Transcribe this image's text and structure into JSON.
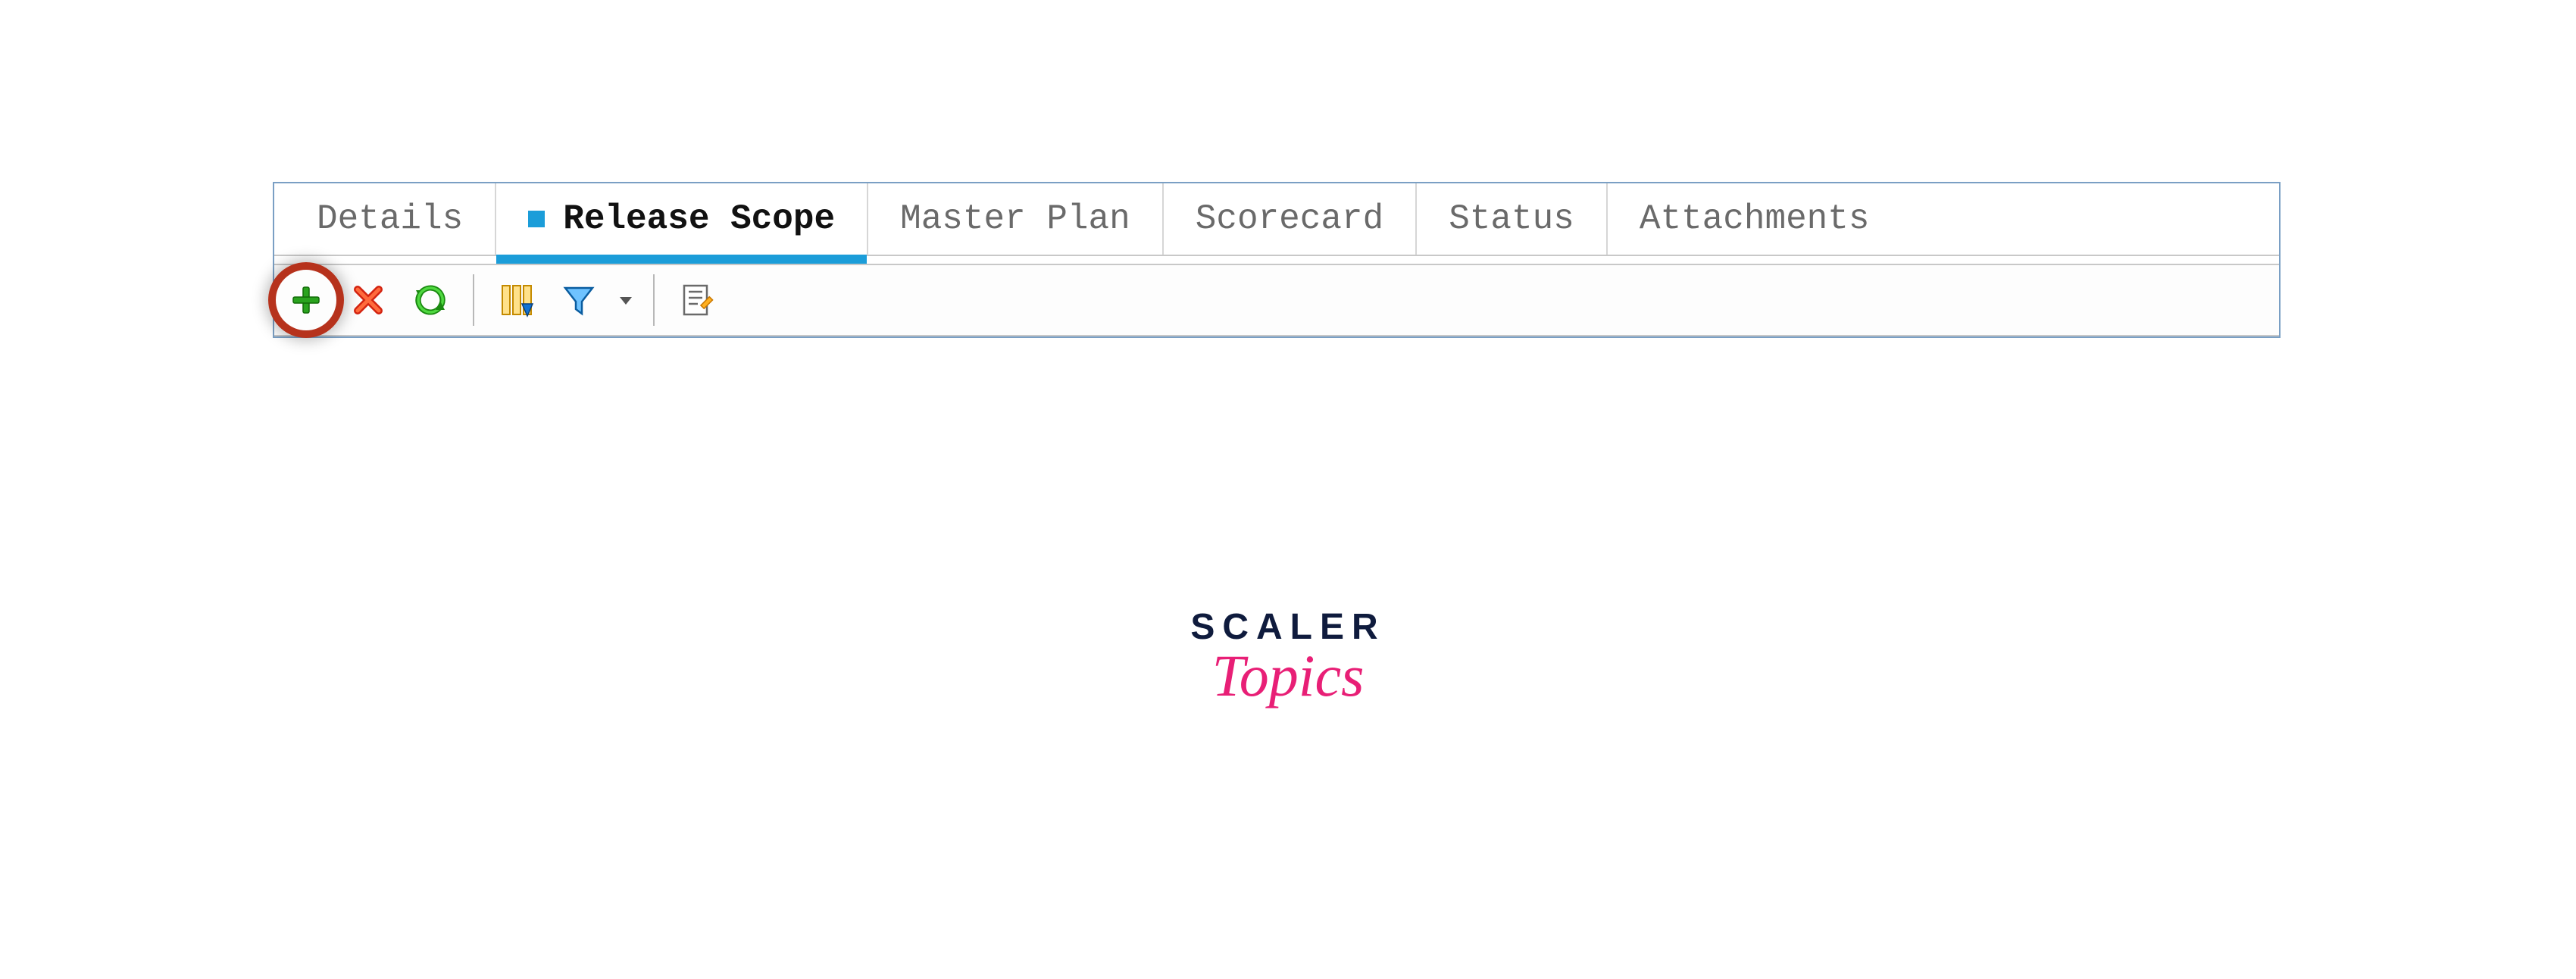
{
  "tabs": {
    "details": "Details",
    "release_scope": "Release Scope",
    "master_plan": "Master Plan",
    "scorecard": "Scorecard",
    "status": "Status",
    "attachments": "Attachments",
    "active": "release_scope"
  },
  "toolbar": {
    "add": "Add",
    "delete": "Delete",
    "refresh": "Refresh",
    "columns": "Select Columns",
    "filter": "Filter",
    "filter_dropdown": "Filter Options",
    "details": "Details"
  },
  "highlight": {
    "target": "add-button"
  },
  "watermark": {
    "line1": "SCALER",
    "line2": "Topics"
  }
}
